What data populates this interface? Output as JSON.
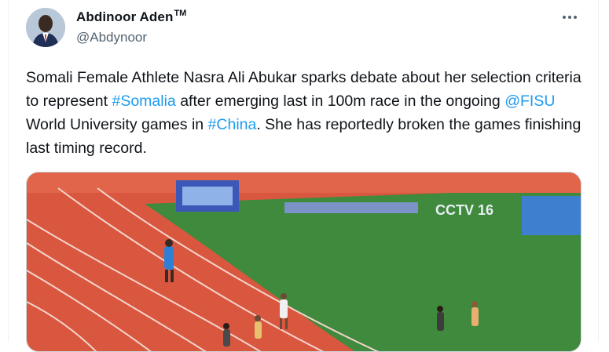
{
  "tweet": {
    "author": {
      "display_name": "Abdinoor Aden",
      "badge": "TM",
      "handle": "@Abdynoor",
      "avatar_icon": "profile-photo"
    },
    "more_icon": "more-options-icon",
    "text_parts": {
      "p1": "Somali Female Athlete Nasra Ali Abukar sparks debate about her selection criteria to represent ",
      "hashtag_somalia": "#Somalia",
      "p2": " after emerging last in 100m race in the ongoing ",
      "mention_fisu": "@FISU",
      "p3": " World University games in ",
      "hashtag_china": "#China",
      "p4": ". She has reportedly broken the games finishing last timing record."
    },
    "media": {
      "broadcast_logo": "CCTV 16",
      "scene": "athletics-track-race"
    },
    "colors": {
      "link": "#1d9bf0",
      "text": "#0f1419",
      "secondary": "#536471",
      "track": "#d9573f",
      "field": "#3f8a3c"
    }
  }
}
